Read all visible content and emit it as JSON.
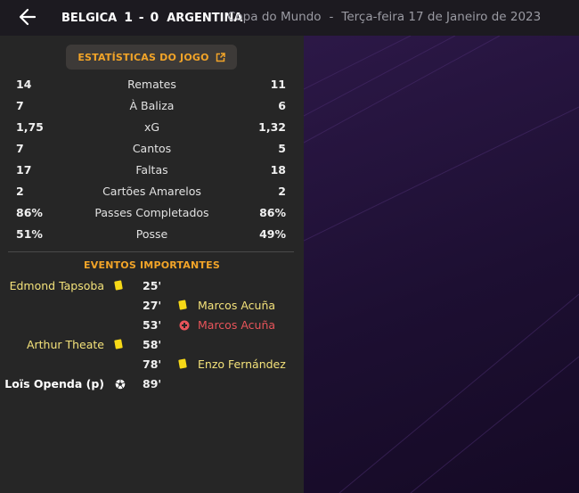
{
  "header": {
    "home_team": "BELGICA",
    "score": "1 - 0",
    "away_team": "ARGENTINA",
    "competition": "Copa do Mundo",
    "separator": "-",
    "date": "Terça-feira 17 de Janeiro de 2023"
  },
  "stats_button": {
    "label": "ESTATÍSTICAS DO JOGO",
    "icon": "external-link-icon"
  },
  "stats": [
    {
      "home": "14",
      "name": "Remates",
      "away": "11"
    },
    {
      "home": "7",
      "name": "À Baliza",
      "away": "6"
    },
    {
      "home": "1,75",
      "name": "xG",
      "away": "1,32"
    },
    {
      "home": "7",
      "name": "Cantos",
      "away": "5"
    },
    {
      "home": "17",
      "name": "Faltas",
      "away": "18"
    },
    {
      "home": "2",
      "name": "Cartões Amarelos",
      "away": "2"
    },
    {
      "home": "86%",
      "name": "Passes Completados",
      "away": "86%"
    },
    {
      "home": "51%",
      "name": "Posse",
      "away": "49%"
    }
  ],
  "events_title": "EVENTOS IMPORTANTES",
  "events": [
    {
      "minute": "25'",
      "home_player": "Edmond Tapsoba",
      "home_icon": "yellow-card-icon",
      "away_player": "",
      "away_icon": ""
    },
    {
      "minute": "27'",
      "home_player": "",
      "home_icon": "",
      "away_player": "Marcos Acuña",
      "away_icon": "yellow-card-icon"
    },
    {
      "minute": "53'",
      "home_player": "",
      "home_icon": "",
      "away_player": "Marcos Acuña",
      "away_icon": "injury-icon"
    },
    {
      "minute": "58'",
      "home_player": "Arthur Theate",
      "home_icon": "yellow-card-icon",
      "away_player": "",
      "away_icon": ""
    },
    {
      "minute": "78'",
      "home_player": "",
      "home_icon": "",
      "away_player": "Enzo Fernández",
      "away_icon": "yellow-card-icon"
    },
    {
      "minute": "89'",
      "home_player": "Loïs Openda (p)",
      "home_icon": "goal-ball-icon",
      "away_player": "",
      "away_icon": ""
    }
  ],
  "colors": {
    "accent": "#f2a428",
    "yellow_card": "#f7d917",
    "injury_red": "#e8545a",
    "panel_bg": "#262626",
    "purple_bg": "#2c1847"
  }
}
